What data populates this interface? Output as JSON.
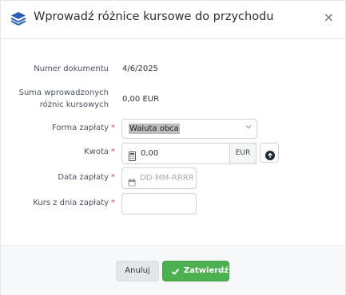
{
  "dialog": {
    "title": "Wprowadź różnice kursowe do przychodu",
    "close_symbol": "×",
    "icon": "layers-icon"
  },
  "form": {
    "document_number": {
      "label": "Numer dokumentu",
      "value": "4/6/2025"
    },
    "sum_diff": {
      "label_line1": "Suma wprowadzonych",
      "label_line2": "różnic kursowych",
      "value": "0,00 EUR"
    },
    "payment_form": {
      "label": "Forma zapłaty",
      "required_mark": "*",
      "selected": "Waluta obca"
    },
    "amount": {
      "label": "Kwota",
      "required_mark": "*",
      "value": "0,00",
      "currency": "EUR"
    },
    "payment_date": {
      "label": "Data zapłaty",
      "required_mark": "*",
      "placeholder": "DD-MM-RRRR"
    },
    "rate": {
      "label": "Kurs z dnia zapłaty",
      "required_mark": "*",
      "value": ""
    }
  },
  "footer": {
    "cancel_label": "Anuluj",
    "confirm_label": "Zatwierdź"
  },
  "colors": {
    "accent_green": "#4caf50",
    "required_red": "#d9534f",
    "header_icon": "#2b5fb3"
  }
}
